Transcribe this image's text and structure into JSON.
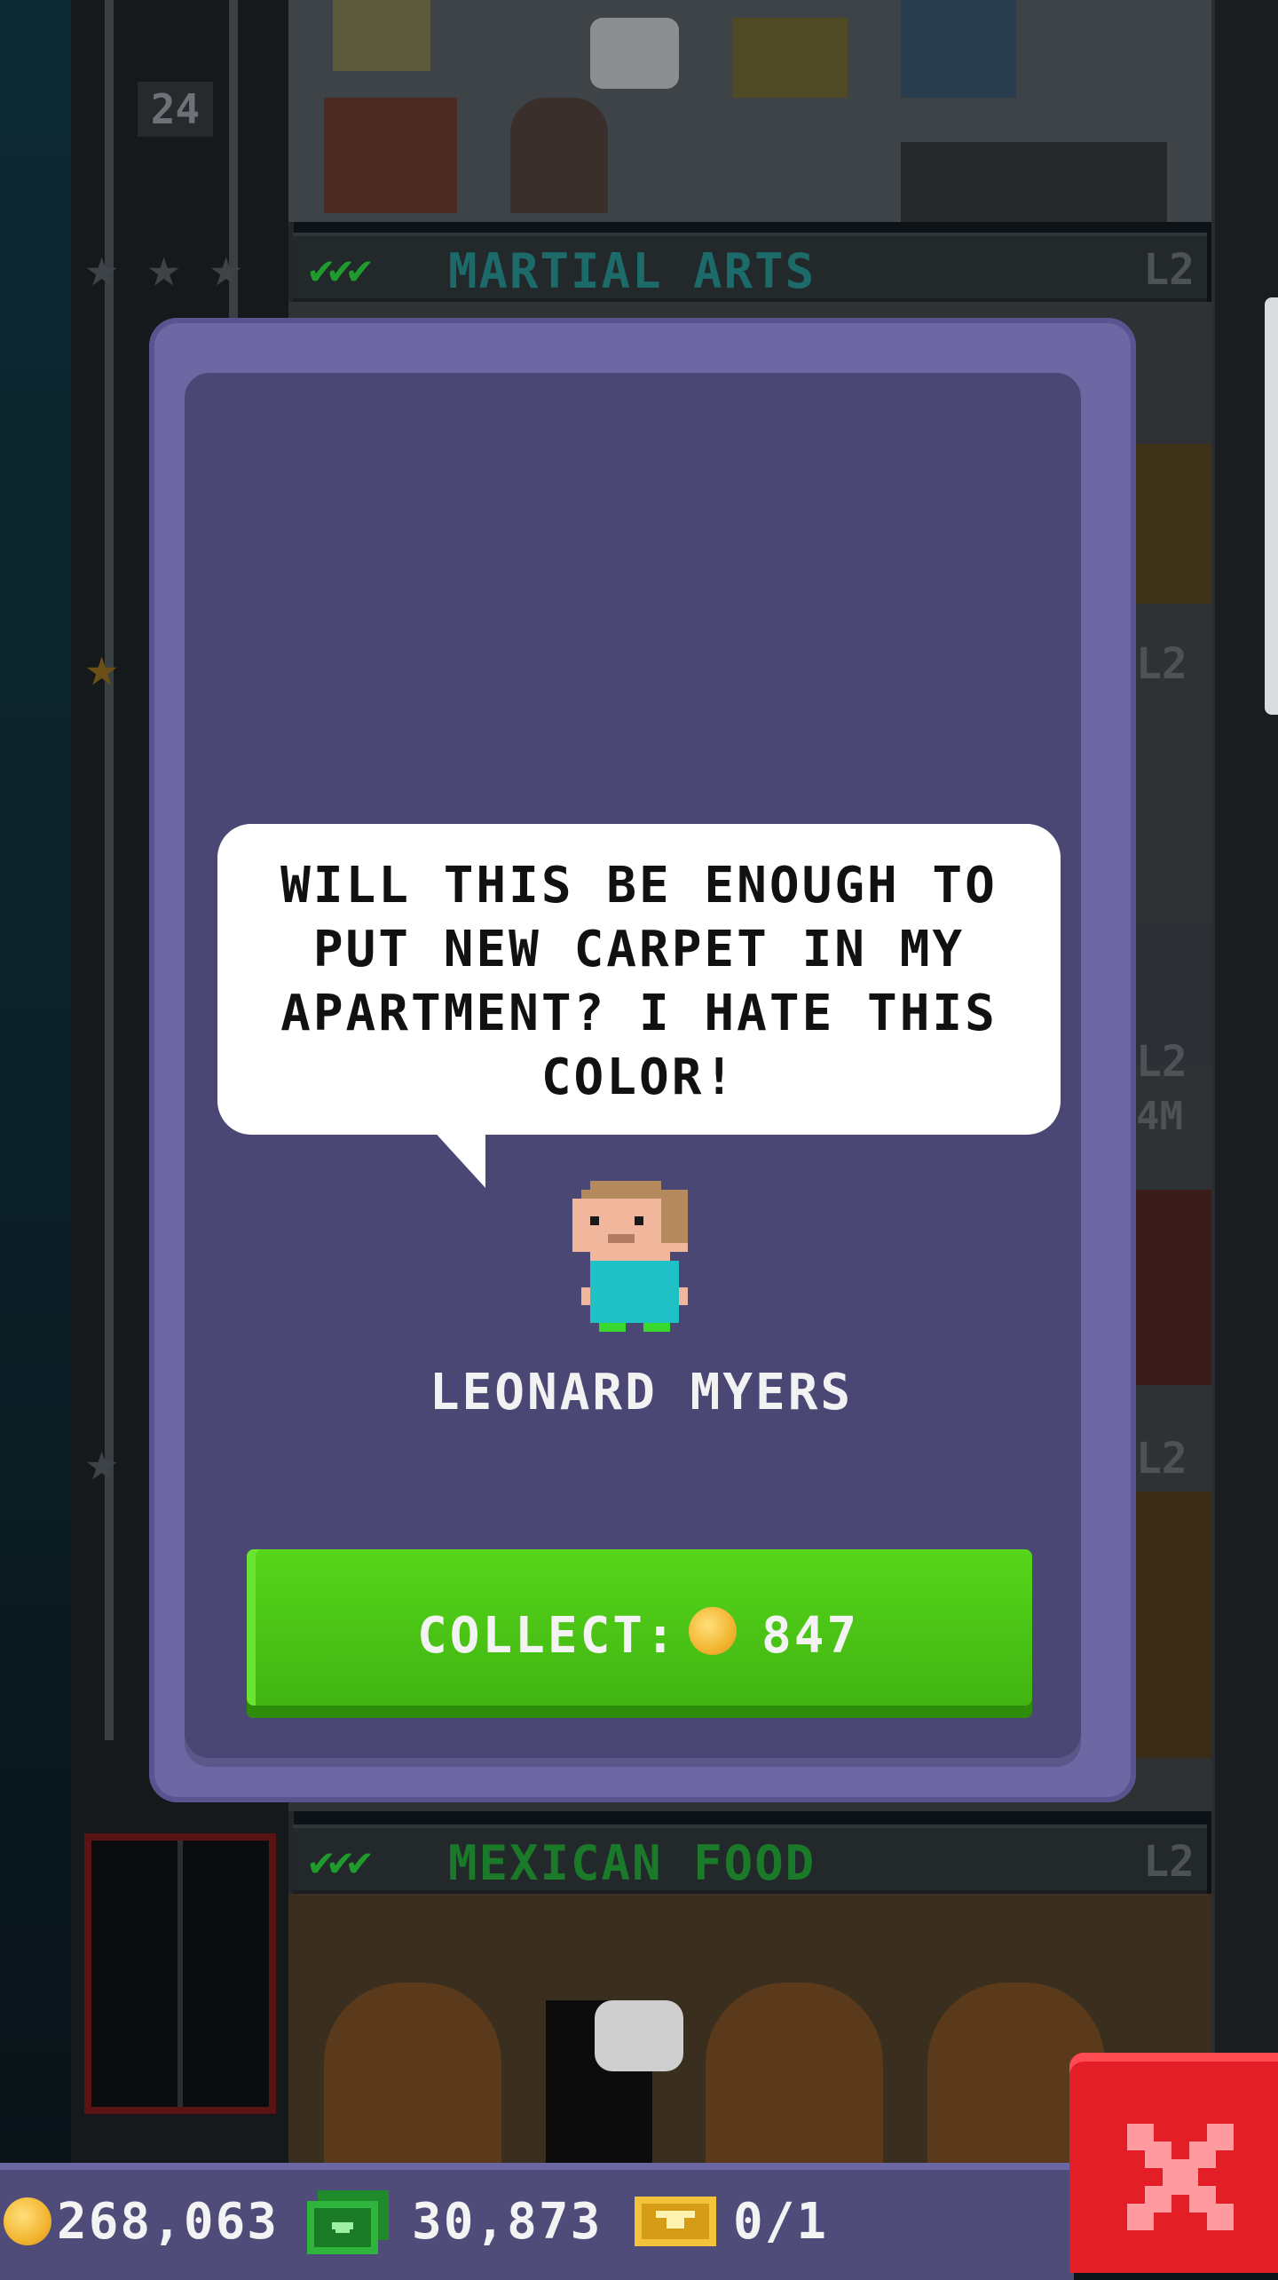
{
  "background": {
    "elevator_floor_number": "24",
    "floors": [
      {
        "name": "MARTIAL ARTS",
        "level": "L2",
        "checks": "✔✔✔",
        "name_color": "#1c6a6a"
      },
      {
        "name": "MEXICAN FOOD",
        "level": "L2",
        "checks": "✔✔✔",
        "name_color": "#1b7a2a"
      }
    ],
    "side_levels": [
      "L2",
      "L2",
      "L2",
      "4M",
      "L2"
    ]
  },
  "dialog": {
    "speech": "WILL THIS BE ENOUGH TO PUT NEW CARPET IN MY APARTMENT? I HATE THIS COLOR!",
    "npc_name": "LEONARD MYERS",
    "collect_label": "COLLECT:",
    "collect_amount": "847",
    "colors": {
      "button": "#4fc816",
      "panel": "#4a4775",
      "frame": "#6e67a3"
    }
  },
  "hud": {
    "coins": "268,063",
    "bux": "30,873",
    "tickets": "0/1"
  },
  "icons": {
    "coin": "coin-icon",
    "bux": "bux-icon",
    "ticket": "golden-ticket-icon",
    "close": "close-icon"
  }
}
